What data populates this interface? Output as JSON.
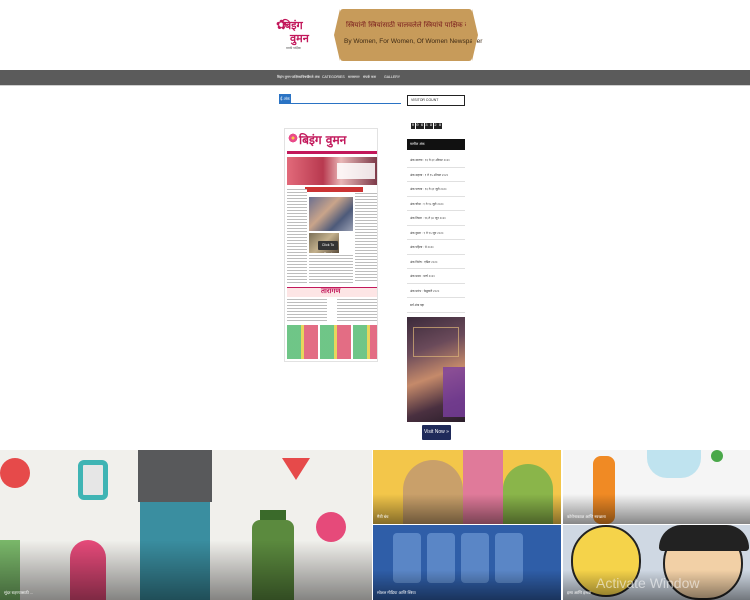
{
  "header": {
    "logo_line1": "बिइंग",
    "logo_line2": "वुमन",
    "logo_sub": "मराठी पाक्षिक",
    "banner_marathi": "स्त्रियांनी स्त्रियांसाठी चालवलेले स्त्रियांचे पाक्षिक वृत्तपत्र",
    "banner_english": "By Women, For Women, Of Women Newspaper"
  },
  "nav": {
    "items": [
      "बिइंग वुमन पाक्षिकाविषयी",
      "ताजे अंक",
      "CATEGORIES",
      "सल्लागार",
      "संपर्क करा",
      "GALLERY"
    ]
  },
  "main": {
    "section_tag": "ई-अंक",
    "paper_title": "बिइंग वुमन",
    "paper_headline": "'आधुनिक सखी' सन्मान",
    "paper_section": "तारांगण",
    "click_label": "Click To Read"
  },
  "sidebar": {
    "search_placeholder": "VISITOR COUNT",
    "counter_digits": [
      "0",
      "0",
      "6",
      "3",
      "9",
      "2",
      "8"
    ],
    "archive_title": "मागील अंक",
    "archive_items": [
      "अंक सातवा : १६ ते ३१ ऑगस्ट २०२०",
      "अंक सहावा : १ ते १५ ऑगस्ट २०२०",
      "अंक पाचवा : १६ ते ३१ जुलै २०२०",
      "अंक चौथा : १ ते १५ जुलै २०२०",
      "अंक तिसरा : १६ ते ३० जून २०२०",
      "अंक दुसरा : १ ते १५ जून २०२०",
      "अंक पहिला : मे २०२०",
      "अंक विशेष : एप्रिल २०२०",
      "अंक प्रथम : मार्च २०२०",
      "अंक प्रारंभ : फेब्रुवारी २०२०",
      "सर्व अंक पहा"
    ],
    "visit_label": "Visit Now »"
  },
  "posts": [
    {
      "caption": "सुंदर राहण्यासाठी ..."
    },
    {
      "caption": "मैत्री बंध"
    },
    {
      "caption": "कोरोनाकाळ आणि स्वच्छता"
    },
    {
      "caption": "सोशल मीडिया आणि स्त्रिया"
    },
    {
      "caption": "हसा आणि हसवा"
    }
  ],
  "os_overlay": "Activate Window",
  "colors": {
    "nav_bg": "#5b5b5b",
    "accent_blue": "#2a73c4",
    "brand_pink": "#c2185b",
    "banner_gold": "#c79b5a"
  }
}
